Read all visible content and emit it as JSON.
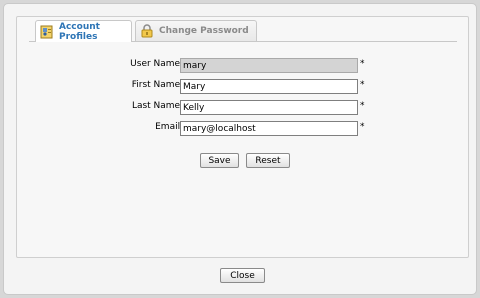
{
  "tabs": [
    {
      "label": "Account Profiles",
      "icon": "user-card-icon",
      "active": true
    },
    {
      "label": "Change Password",
      "icon": "lock-icon",
      "active": false
    }
  ],
  "form": {
    "username": {
      "label": "User Name :",
      "value": "mary",
      "readonly": true,
      "required": "*"
    },
    "first_name": {
      "label": "First Name :",
      "value": "Mary",
      "required": "*"
    },
    "last_name": {
      "label": "Last Name :",
      "value": "Kelly",
      "required": "*"
    },
    "email": {
      "label": "Email :",
      "value": "mary@localhost",
      "required": "*"
    }
  },
  "buttons": {
    "save": "Save",
    "reset": "Reset",
    "close": "Close"
  },
  "colors": {
    "active_tab_text": "#2e75b6",
    "inactive_tab_text": "#8a8a8a",
    "readonly_bg": "#d4d4d4"
  }
}
